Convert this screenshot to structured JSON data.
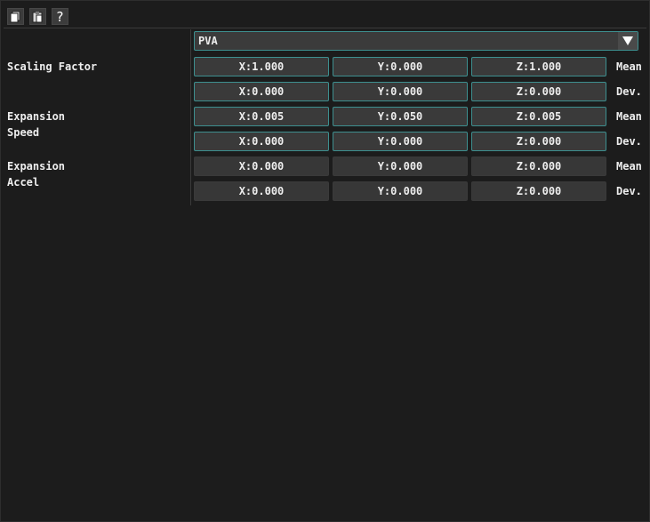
{
  "toolbar": {
    "items": [
      {
        "icon": "copy-icon"
      },
      {
        "icon": "paste-icon"
      },
      {
        "icon": "help-icon",
        "glyph": "?"
      }
    ]
  },
  "mode_dropdown": {
    "value": "PVA",
    "arrow": "▼"
  },
  "sections": [
    {
      "label": "Scaling Factor"
    },
    {
      "label": "Expansion\nSpeed"
    },
    {
      "label": "Expansion\nAccel"
    }
  ],
  "rows": [
    {
      "x": "X:1.000",
      "y": "Y:0.000",
      "z": "Z:1.000",
      "suffix": "Mean",
      "enabled": true
    },
    {
      "x": "X:0.000",
      "y": "Y:0.000",
      "z": "Z:0.000",
      "suffix": "Dev.",
      "enabled": true
    },
    {
      "x": "X:0.005",
      "y": "Y:0.050",
      "z": "Z:0.005",
      "suffix": "Mean",
      "enabled": true
    },
    {
      "x": "X:0.000",
      "y": "Y:0.000",
      "z": "Z:0.000",
      "suffix": "Dev.",
      "enabled": true
    },
    {
      "x": "X:0.000",
      "y": "Y:0.000",
      "z": "Z:0.000",
      "suffix": "Mean",
      "enabled": false
    },
    {
      "x": "X:0.000",
      "y": "Y:0.000",
      "z": "Z:0.000",
      "suffix": "Dev.",
      "enabled": false
    }
  ]
}
